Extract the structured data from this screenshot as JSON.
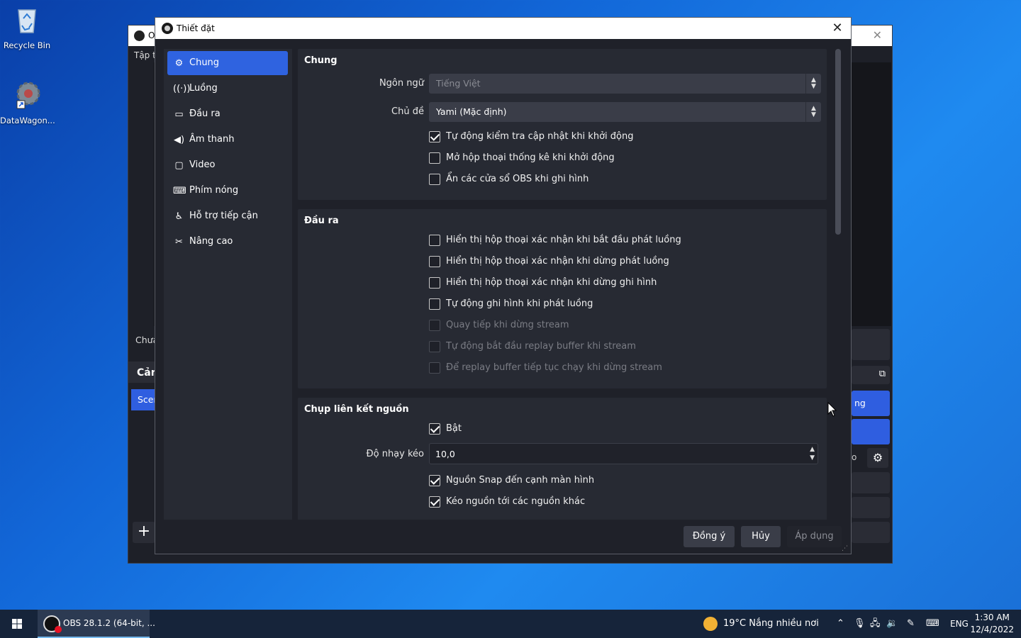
{
  "desktop": {
    "icons": [
      {
        "label": "Recycle Bin"
      },
      {
        "label": "DataWagon..."
      }
    ]
  },
  "obs_main": {
    "title_fragment": "O",
    "menu_fragment": "Tập ti",
    "status_fragment": "Chưa",
    "panel_title_fragment": "Cản",
    "scene_fragment": "Scen",
    "right_button_fragment": "ng",
    "right_button2_fragment": "o"
  },
  "dialog": {
    "title": "Thiết đặt",
    "close_glyph": "✕",
    "nav": [
      {
        "label": "Chung",
        "icon": "gear-icon",
        "glyph": "⚙",
        "active": true
      },
      {
        "label": "Luồng",
        "icon": "antenna-icon",
        "glyph": "📶",
        "active": false
      },
      {
        "label": "Đầu ra",
        "icon": "output-icon",
        "glyph": "🖵",
        "active": false
      },
      {
        "label": "Âm thanh",
        "icon": "speaker-icon",
        "glyph": "🔊",
        "active": false
      },
      {
        "label": "Video",
        "icon": "monitor-icon",
        "glyph": "🖵",
        "active": false
      },
      {
        "label": "Phím nóng",
        "icon": "keyboard-icon",
        "glyph": "⌨",
        "active": false
      },
      {
        "label": "Hỗ trợ tiếp cận",
        "icon": "accessibility-icon",
        "glyph": "♿",
        "active": false
      },
      {
        "label": "Nâng cao",
        "icon": "tools-icon",
        "glyph": "✂",
        "active": false
      }
    ],
    "general": {
      "title": "Chung",
      "language_label": "Ngôn ngữ",
      "language_value": "Tiếng Việt",
      "theme_label": "Chủ đề",
      "theme_value": "Yami (Mặc định)",
      "checks": [
        {
          "label": "Tự động kiểm tra cập nhật khi khởi động",
          "checked": true,
          "disabled": false
        },
        {
          "label": "Mở hộp thoại thống kê khi khởi động",
          "checked": false,
          "disabled": false
        },
        {
          "label": "Ẩn các cửa sổ OBS khi ghi hình",
          "checked": false,
          "disabled": false
        }
      ]
    },
    "output": {
      "title": "Đầu ra",
      "checks": [
        {
          "label": "Hiển thị hộp thoại xác nhận khi bắt đầu phát luồng",
          "checked": false,
          "disabled": false
        },
        {
          "label": "Hiển thị hộp thoại xác nhận khi dừng phát luồng",
          "checked": false,
          "disabled": false
        },
        {
          "label": "Hiển thị hộp thoại xác nhận khi dừng ghi hình",
          "checked": false,
          "disabled": false
        },
        {
          "label": "Tự động ghi hình khi phát luồng",
          "checked": false,
          "disabled": false
        },
        {
          "label": "Quay tiếp khi dừng stream",
          "checked": false,
          "disabled": true
        },
        {
          "label": "Tự động bắt đầu replay buffer khi stream",
          "checked": false,
          "disabled": true
        },
        {
          "label": "Để replay buffer tiếp tục chạy khi dừng stream",
          "checked": false,
          "disabled": true
        }
      ]
    },
    "snapping": {
      "title": "Chụp liên kết nguồn",
      "enable_label": "Bật",
      "enable_checked": true,
      "sensitivity_label": "Độ nhạy kéo",
      "sensitivity_value": "10,0",
      "checks": [
        {
          "label": "Nguồn Snap đến cạnh màn hình",
          "checked": true,
          "disabled": false
        },
        {
          "label": "Kéo nguồn tới các nguồn khác",
          "checked": true,
          "disabled": false
        }
      ]
    },
    "buttons": {
      "ok": "Đồng ý",
      "cancel": "Hủy",
      "apply": "Áp dụng"
    }
  },
  "taskbar": {
    "app_label": "OBS 28.1.2 (64-bit, ...",
    "weather": "19°C  Nắng nhiều nơi",
    "language": "ENG",
    "time": "1:30 AM",
    "date": "12/4/2022"
  },
  "colors": {
    "accent": "#2f63e0",
    "dialog_bg": "#1f2129",
    "group_bg": "#272a33"
  }
}
